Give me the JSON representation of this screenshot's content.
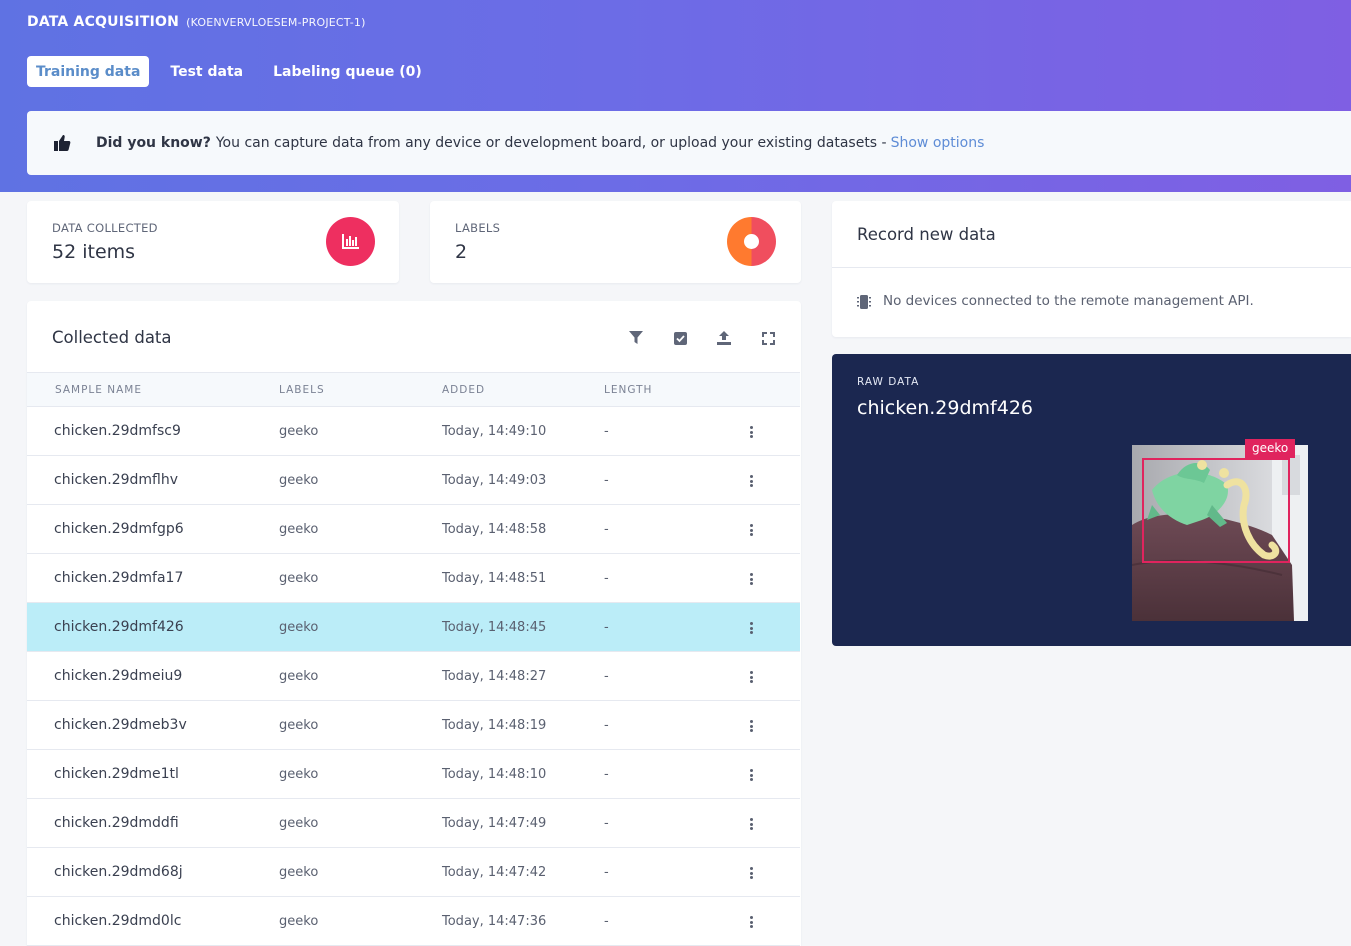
{
  "header": {
    "title": "DATA ACQUISITION",
    "project": "(KOENVERVLOESEM-PROJECT-1)",
    "tabs": [
      {
        "label": "Training data",
        "active": true
      },
      {
        "label": "Test data",
        "active": false
      },
      {
        "label": "Labeling queue (0)",
        "active": false
      }
    ]
  },
  "tip": {
    "icon": "thumbs-up-icon",
    "lead": "Did you know?",
    "text": "You can capture data from any device or development board, or upload your existing datasets -",
    "link": "Show options"
  },
  "stats": {
    "collected_label": "DATA COLLECTED",
    "collected_value": "52 items",
    "collected_icon": "bar-chart-icon",
    "collected_color": "#ee2f60",
    "labels_label": "LABELS",
    "labels_value": "2",
    "labels_icon": "pie-chart-icon",
    "labels_colors": [
      "#f04e5e",
      "#ff7a2f"
    ]
  },
  "collected": {
    "title": "Collected data",
    "toolbar": [
      "filter-icon",
      "select-icon",
      "upload-icon",
      "expand-icon"
    ],
    "columns": [
      "SAMPLE NAME",
      "LABELS",
      "ADDED",
      "LENGTH"
    ],
    "rows": [
      {
        "name": "chicken.29dmfsc9",
        "label": "geeko",
        "added": "Today, 14:49:10",
        "length": "-",
        "selected": false
      },
      {
        "name": "chicken.29dmflhv",
        "label": "geeko",
        "added": "Today, 14:49:03",
        "length": "-",
        "selected": false
      },
      {
        "name": "chicken.29dmfgp6",
        "label": "geeko",
        "added": "Today, 14:48:58",
        "length": "-",
        "selected": false
      },
      {
        "name": "chicken.29dmfa17",
        "label": "geeko",
        "added": "Today, 14:48:51",
        "length": "-",
        "selected": false
      },
      {
        "name": "chicken.29dmf426",
        "label": "geeko",
        "added": "Today, 14:48:45",
        "length": "-",
        "selected": true
      },
      {
        "name": "chicken.29dmeiu9",
        "label": "geeko",
        "added": "Today, 14:48:27",
        "length": "-",
        "selected": false
      },
      {
        "name": "chicken.29dmeb3v",
        "label": "geeko",
        "added": "Today, 14:48:19",
        "length": "-",
        "selected": false
      },
      {
        "name": "chicken.29dme1tl",
        "label": "geeko",
        "added": "Today, 14:48:10",
        "length": "-",
        "selected": false
      },
      {
        "name": "chicken.29dmddfi",
        "label": "geeko",
        "added": "Today, 14:47:49",
        "length": "-",
        "selected": false
      },
      {
        "name": "chicken.29dmd68j",
        "label": "geeko",
        "added": "Today, 14:47:42",
        "length": "-",
        "selected": false
      },
      {
        "name": "chicken.29dmd0lc",
        "label": "geeko",
        "added": "Today, 14:47:36",
        "length": "-",
        "selected": false
      }
    ]
  },
  "record": {
    "title": "Record new data",
    "message": "No devices connected to the remote management API."
  },
  "raw": {
    "label": "RAW DATA",
    "name": "chicken.29dmf426",
    "bbox_label": "geeko",
    "bbox_color": "#e0245e"
  }
}
